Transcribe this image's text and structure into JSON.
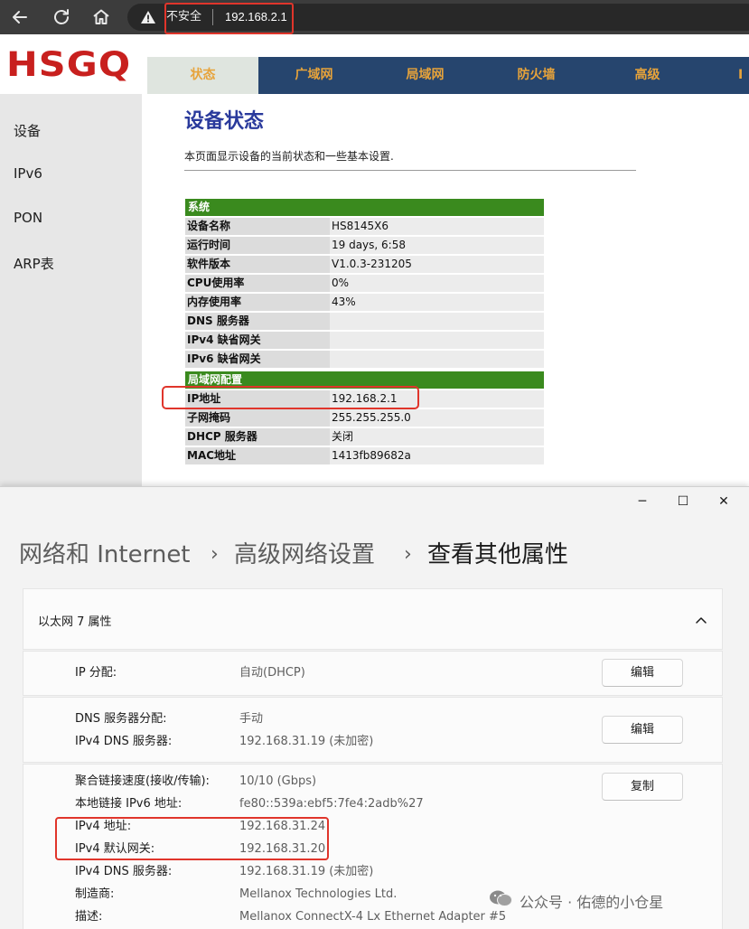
{
  "browser": {
    "security_label": "不安全",
    "url": "192.168.2.1"
  },
  "router": {
    "logo": "HSGQ",
    "tabs": [
      "状态",
      "广域网",
      "局域网",
      "防火墙",
      "高级",
      "I"
    ],
    "sidebar": [
      "设备",
      "IPv6",
      "PON",
      "ARP表"
    ],
    "title": "设备状态",
    "description": "本页面显示设备的当前状态和一些基本设置.",
    "sections": [
      {
        "header": "系统",
        "rows": [
          {
            "key": "设备名称",
            "value": "HS8145X6"
          },
          {
            "key": "运行时间",
            "value": "19 days, 6:58"
          },
          {
            "key": "软件版本",
            "value": "V1.0.3-231205"
          },
          {
            "key": "CPU使用率",
            "value": "0%"
          },
          {
            "key": "内存使用率",
            "value": "43%"
          },
          {
            "key": "DNS 服务器",
            "value": ""
          },
          {
            "key": "IPv4 缺省网关",
            "value": ""
          },
          {
            "key": "IPv6 缺省网关",
            "value": ""
          }
        ]
      },
      {
        "header": "局域网配置",
        "rows": [
          {
            "key": "IP地址",
            "value": "192.168.2.1"
          },
          {
            "key": "子网掩码",
            "value": "255.255.255.0"
          },
          {
            "key": "DHCP 服务器",
            "value": "关闭"
          },
          {
            "key": "MAC地址",
            "value": "1413fb89682a"
          }
        ]
      }
    ]
  },
  "settings": {
    "window_controls": {
      "minimize": "─",
      "maximize": "☐",
      "close": "✕"
    },
    "breadcrumb": [
      "网络和 Internet",
      "高级网络设置",
      "查看其他属性"
    ],
    "breadcrumb_sep": "›",
    "card_title": "以太网 7 属性",
    "ip_assignment": {
      "label": "IP 分配:",
      "value": "自动(DHCP)",
      "button": "编辑"
    },
    "dns": {
      "rows": [
        {
          "label": "DNS 服务器分配:",
          "value": "手动"
        },
        {
          "label": "IPv4 DNS 服务器:",
          "value": "192.168.31.19 (未加密)"
        }
      ],
      "button": "编辑"
    },
    "details": {
      "rows": [
        {
          "label": "聚合链接速度(接收/传输):",
          "value": "10/10 (Gbps)"
        },
        {
          "label": "本地链接 IPv6 地址:",
          "value": "fe80::539a:ebf5:7fe4:2adb%27"
        },
        {
          "label": "IPv4 地址:",
          "value": "192.168.31.24"
        },
        {
          "label": "IPv4 默认网关:",
          "value": "192.168.31.20"
        },
        {
          "label": "IPv4 DNS 服务器:",
          "value": "192.168.31.19 (未加密)"
        },
        {
          "label": "制造商:",
          "value": "Mellanox Technologies Ltd."
        },
        {
          "label": "描述:",
          "value": "Mellanox ConnectX-4 Lx Ethernet Adapter #5"
        }
      ],
      "button": "复制"
    }
  },
  "watermark": {
    "text": "公众号 · 佑德的小仓星"
  },
  "colors": {
    "highlight": "#e0352b",
    "router_nav": "#26456e",
    "router_tab_text": "#e7a33a",
    "router_section": "#3a8a1e",
    "router_title": "#2a3a9c",
    "logo": "#c8201e"
  },
  "icons": {
    "back": "arrow-left-icon",
    "reload": "reload-icon",
    "home": "home-icon",
    "security": "warning-triangle-icon",
    "collapse": "chevron-up-icon",
    "watermark": "wechat-icon"
  }
}
